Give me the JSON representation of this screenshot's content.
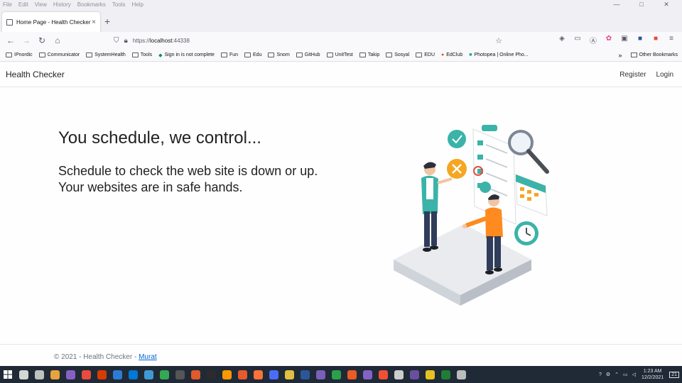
{
  "menu": [
    "File",
    "Edit",
    "View",
    "History",
    "Bookmarks",
    "Tools",
    "Help"
  ],
  "window_controls": [
    "—",
    "□",
    "✕"
  ],
  "tab": {
    "title": "Home Page - Health Checker",
    "close": "×"
  },
  "new_tab": "+",
  "url": {
    "scheme": "https://",
    "host": "localhost",
    "port": ":44338"
  },
  "bookmarks": [
    "IPnordic",
    "Communicator",
    "SystemHealth",
    "Tools",
    "Sign in is not complete",
    "Fun",
    "Edu",
    "Snom",
    "GitHub",
    "UnitTest",
    "Takip",
    "Sosyal",
    "EDU",
    "EdClub",
    "Photopea | Online Pho..."
  ],
  "other_bookmarks": "Other Bookmarks",
  "site": {
    "brand": "Health Checker",
    "nav": {
      "register": "Register",
      "login": "Login"
    },
    "hero_title": "You schedule, we control...",
    "hero_text": "Schedule to check the web site is down or up. Your websites are in safe hands.",
    "footer_text": "© 2021 - Health Checker - ",
    "footer_link": "Murat"
  },
  "taskbar": {
    "time": "1:23 AM",
    "date": "12/2/2021",
    "notification_count": "21",
    "icon_colors": [
      "#d6d6d6",
      "#c0c0c0",
      "#e8a33d",
      "#8661c5",
      "#e74c3c",
      "#d83b01",
      "#2d7bd6",
      "#0078d4",
      "#3e9ad6",
      "#34a853",
      "#555555",
      "#e05a2b",
      "#2b2b2b",
      "#ff9800",
      "#e55b2c",
      "#ff7139",
      "#4a6cf7",
      "#e0c040",
      "#2b579a",
      "#7a5fb8",
      "#2ba04a",
      "#ee5a24",
      "#8661c5",
      "#f05033",
      "#cccccc",
      "#6a4ea0",
      "#e7c021",
      "#1e7e34",
      "#bbbbbb"
    ]
  }
}
